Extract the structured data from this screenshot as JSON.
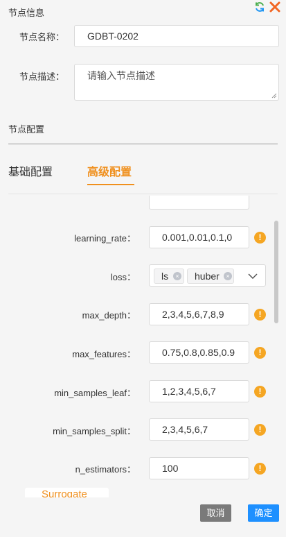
{
  "node_info": {
    "title": "节点信息",
    "name_label": "节点名称：",
    "name_value": "GDBT-0202",
    "desc_label": "节点描述：",
    "desc_placeholder": "请输入节点描述"
  },
  "node_config": {
    "title": "节点配置",
    "tabs": [
      {
        "label": "基础配置",
        "active": false
      },
      {
        "label": "高级配置",
        "active": true
      }
    ]
  },
  "params": {
    "learning_rate": {
      "label": "learning_rate：",
      "value": "0.001,0.01,0.1,0"
    },
    "loss": {
      "label": "loss：",
      "tags": [
        "ls",
        "huber"
      ]
    },
    "max_depth": {
      "label": "max_depth：",
      "value": "2,3,4,5,6,7,8,9"
    },
    "max_features": {
      "label": "max_features：",
      "value": "0.75,0.8,0.85,0.9"
    },
    "min_samples_leaf": {
      "label": "min_samples_leaf：",
      "value": "1,2,3,4,5,6,7"
    },
    "min_samples_split": {
      "label": "min_samples_split：",
      "value": "2,3,4,5,6,7"
    },
    "n_estimators": {
      "label": "n_estimators：",
      "value": "100"
    }
  },
  "surrogate_label": "Surrogate",
  "footer": {
    "cancel_label": "取消",
    "ok_label": "确定"
  },
  "icons": {
    "refresh": "refresh-icon",
    "close": "close-icon",
    "warning": "warning-icon",
    "chevron": "chevron-down-icon"
  },
  "colors": {
    "accent": "#f0901e",
    "primary_button": "#1e90ff",
    "cancel_button": "#7a7a7a",
    "warning": "#f5a623",
    "refresh_green": "#4caf50",
    "refresh_blue": "#2196f3",
    "close_orange": "#f26522"
  }
}
